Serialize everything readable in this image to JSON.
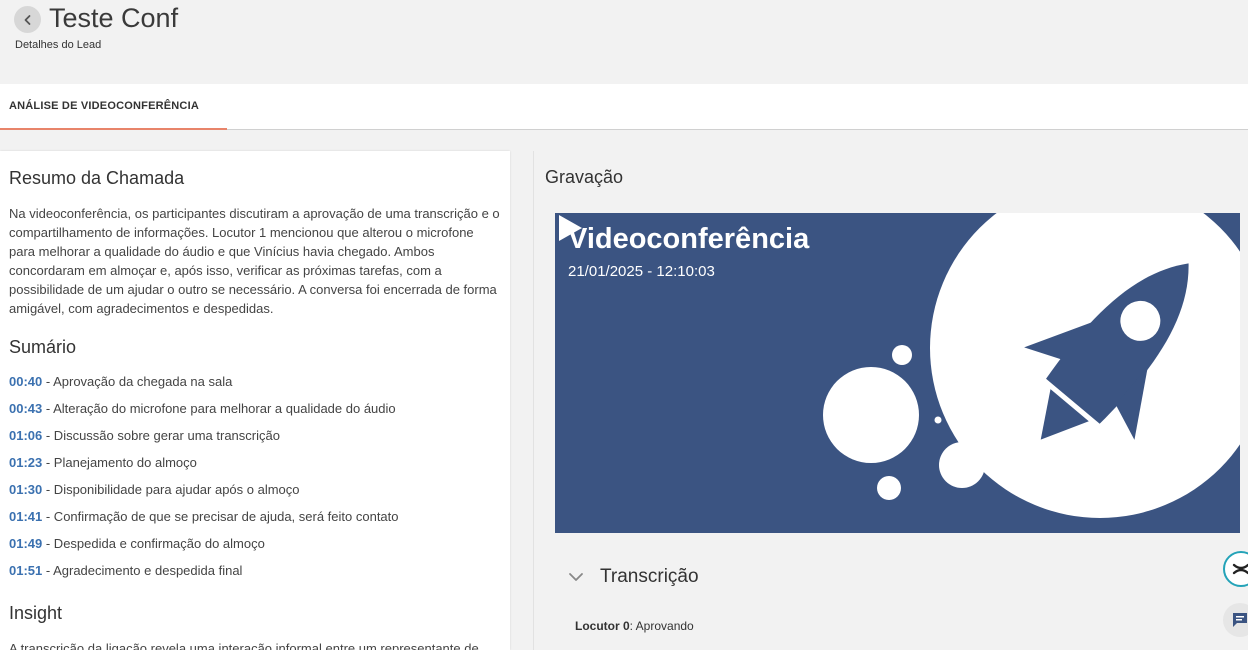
{
  "header": {
    "title": "Teste Conf",
    "subtitle": "Detalhes do Lead"
  },
  "tabs": [
    {
      "label": "ANÁLISE DE VIDEOCONFERÊNCIA",
      "active": true
    }
  ],
  "left": {
    "summary_title": "Resumo da Chamada",
    "summary_text": "Na videoconferência, os participantes discutiram a aprovação de uma transcrição e o compartilhamento de informações. Locutor 1 mencionou que alterou o microfone para melhorar a qualidade do áudio e que Vinícius havia chegado. Ambos concordaram em almoçar e, após isso, verificar as próximas tarefas, com a possibilidade de um ajudar o outro se necessário. A conversa foi encerrada de forma amigável, com agradecimentos e despedidas.",
    "sumario_title": "Sumário",
    "sumario": [
      {
        "time": "00:40",
        "text": " - Aprovação da chegada na sala"
      },
      {
        "time": "00:43",
        "text": " - Alteração do microfone para melhorar a qualidade do áudio"
      },
      {
        "time": "01:06",
        "text": " - Discussão sobre gerar uma transcrição"
      },
      {
        "time": "01:23",
        "text": " - Planejamento do almoço"
      },
      {
        "time": "01:30",
        "text": " - Disponibilidade para ajudar após o almoço"
      },
      {
        "time": "01:41",
        "text": " - Confirmação de que se precisar de ajuda, será feito contato"
      },
      {
        "time": "01:49",
        "text": " - Despedida e confirmação do almoço"
      },
      {
        "time": "01:51",
        "text": " - Agradecimento e despedida final"
      }
    ],
    "insight_title": "Insight",
    "insight_text": "A transcrição da ligação revela uma interação informal entre um representante de"
  },
  "right": {
    "recording_title": "Gravação",
    "video": {
      "title": "Videoconferência",
      "date": "21/01/2025 - 12:10:03"
    },
    "transcription_title": "Transcrição",
    "transcript": [
      {
        "speaker": "Locutor 0",
        "text": ": Aprovando"
      }
    ]
  },
  "colors": {
    "accent_tab": "#e8846a",
    "timestamp": "#3b71b0",
    "video_bg": "#3b5482",
    "fab_border": "#24a3b8"
  },
  "icons": {
    "back": "chevron-left-icon",
    "play": "play-icon",
    "collapse": "chevron-down-icon",
    "fab1": "support-icon",
    "fab2": "chat-icon"
  }
}
